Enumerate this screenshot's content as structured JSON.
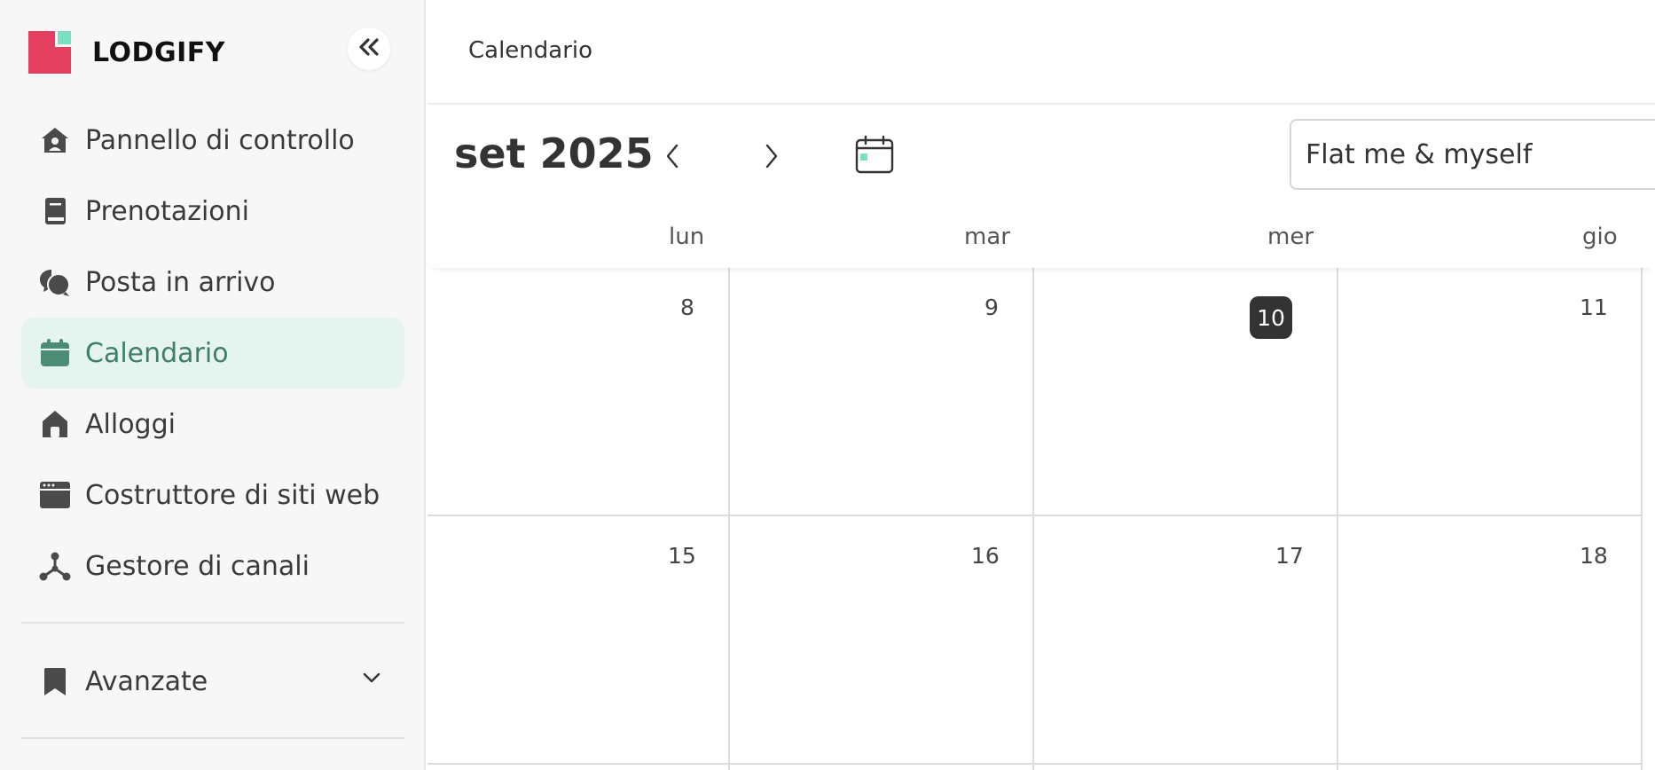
{
  "app": {
    "brand_name": "LODGIFY",
    "colors": {
      "brand_red": "#e3415f",
      "brand_mint": "#7be0c1",
      "active_bg": "#e5f4ef",
      "active_text": "#3f7e67"
    }
  },
  "sidebar": {
    "collapse_icon": "double-chevron-left-icon",
    "items": [
      {
        "label": "Pannello di controllo",
        "icon": "home-icon",
        "active": false
      },
      {
        "label": "Prenotazioni",
        "icon": "book-icon",
        "active": false
      },
      {
        "label": "Posta in arrivo",
        "icon": "chat-bubbles-icon",
        "active": false
      },
      {
        "label": "Calendario",
        "icon": "calendar-icon",
        "active": true
      },
      {
        "label": "Alloggi",
        "icon": "house-icon",
        "active": false
      },
      {
        "label": "Costruttore di siti web",
        "icon": "browser-window-icon",
        "active": false
      },
      {
        "label": "Gestore di canali",
        "icon": "network-icon",
        "active": false
      }
    ],
    "advanced": {
      "label": "Avanzate",
      "icon": "bookmark-icon",
      "expand_icon": "chevron-down-icon"
    }
  },
  "header": {
    "title": "Calendario"
  },
  "toolbar": {
    "month_label": "set 2025",
    "prev_icon": "chevron-left-icon",
    "next_icon": "chevron-right-icon",
    "today_icon": "calendar-today-icon",
    "property_select_value": "Flat me & myself"
  },
  "calendar": {
    "weekdays": [
      "lun",
      "mar",
      "mer",
      "gio"
    ],
    "weeks": [
      [
        "8",
        "9",
        "10",
        "11"
      ],
      [
        "15",
        "16",
        "17",
        "18"
      ]
    ],
    "today": "10"
  }
}
